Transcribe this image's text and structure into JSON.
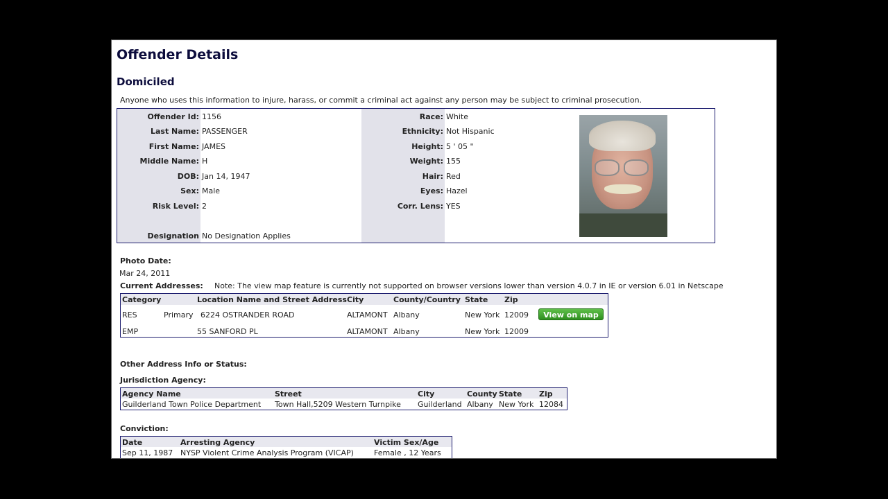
{
  "header": {
    "title": "Offender Details",
    "status": "Domiciled",
    "warning": "Anyone who uses this information to injure, harass, or commit a criminal act against any person may be subject to criminal prosecution."
  },
  "details": {
    "left": [
      {
        "label": "Offender Id:",
        "value": "1156"
      },
      {
        "label": "Last Name:",
        "value": "PASSENGER"
      },
      {
        "label": "First Name:",
        "value": "JAMES"
      },
      {
        "label": "Middle Name:",
        "value": "H"
      },
      {
        "label": "DOB:",
        "value": "Jan 14, 1947"
      },
      {
        "label": "Sex:",
        "value": "Male"
      },
      {
        "label": "Risk Level:",
        "value": "2"
      }
    ],
    "designation": {
      "label": "Designation",
      "value": "No Designation Applies"
    },
    "right": [
      {
        "label": "Race:",
        "value": "White"
      },
      {
        "label": "Ethnicity:",
        "value": "Not Hispanic"
      },
      {
        "label": "Height:",
        "value": "5 ' 05 \""
      },
      {
        "label": "Weight:",
        "value": "155"
      },
      {
        "label": "Hair:",
        "value": "Red"
      },
      {
        "label": "Eyes:",
        "value": "Hazel"
      },
      {
        "label": "Corr. Lens:",
        "value": "YES"
      }
    ]
  },
  "photo": {
    "date_label": "Photo Date:",
    "date": "Mar 24, 2011"
  },
  "addresses": {
    "label": "Current Addresses:",
    "note": "Note: The view map feature is currently not supported on browser versions lower than version 4.0.7 in IE or version 6.01 in Netscape",
    "headers": [
      "Category",
      "Location Name and Street Address",
      "City",
      "County/Country",
      "State",
      "Zip"
    ],
    "rows": [
      {
        "category": "RES",
        "type": "Primary",
        "street": "6224 OSTRANDER ROAD",
        "city": "ALTAMONT",
        "county": "Albany",
        "state": "New York",
        "zip": "12009"
      },
      {
        "category": "EMP",
        "type": "",
        "street": "55 SANFORD PL",
        "city": "ALTAMONT",
        "county": "Albany",
        "state": "New York",
        "zip": "12009"
      }
    ],
    "map_button": "View on map"
  },
  "other_info": {
    "label": "Other Address Info or Status:"
  },
  "jurisdiction": {
    "label": "Jurisdiction Agency:",
    "headers": [
      "Agency Name",
      "Street",
      "City",
      "County",
      "State",
      "Zip"
    ],
    "row": {
      "agency": "Guilderland Town Police Department",
      "street": "Town Hall,5209 Western Turnpike",
      "city": "Guilderland",
      "county": "Albany",
      "state": "New York",
      "zip": "12084"
    }
  },
  "conviction": {
    "label": "Conviction:",
    "headers": [
      "Date",
      "Arresting Agency",
      "Victim Sex/Age"
    ],
    "row": {
      "date": "Sep 11, 1987",
      "agency": "NYSP Violent Crime Analysis Program (VICAP)",
      "victim": "Female , 12 Years"
    }
  }
}
